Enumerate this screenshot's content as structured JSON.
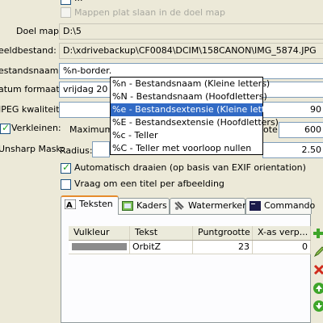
{
  "options": {
    "mirror_action_label": "...",
    "flatten_folders_label": "Mappen plat slaan in de doel map"
  },
  "form": {
    "target_folder_label": "Doel map:",
    "target_folder_value": "D:\\5",
    "example_file_label": "eeldbestand:",
    "example_file_value": "D:\\xdrivebackup\\CF0084\\DCIM\\158CANON\\IMG_5874.JPG",
    "filename_label": "estandsnaam:",
    "filename_value": "%n-border.",
    "date_format_label": "atum formaat:",
    "date_format_value": "vrijdag 20 ja",
    "jpeg_quality_label": "JPEG kwaliteit:",
    "jpeg_quality_value": "90",
    "resize_label": "Verkleinen:",
    "max_width_label": "Maximum bre",
    "max_height_label_tail": "ote:",
    "max_height_value": "600",
    "unsharp_label": "Unsharp Mask:",
    "radius_label": "Radius:",
    "radius_value": "2.50"
  },
  "dropdown": {
    "items": [
      "%n - Bestandsnaam (Kleine letters)",
      "%N - Bestandsnaam (Hoofdletters)",
      "%e - Bestandsextensie (Kleine letters)",
      "%E - Bestandsextensie (Hoofdletters)",
      "%c - Teller",
      "%C - Teller met voorloop nullen"
    ],
    "selected_index": 2
  },
  "checkboxes": {
    "auto_rotate_label": "Automatisch draaien (op basis van EXIF orientation)",
    "ask_title_label": "Vraag om een titel per afbeelding"
  },
  "tabs": [
    {
      "label": "Teksten"
    },
    {
      "label": "Kaders"
    },
    {
      "label": "Watermerken"
    },
    {
      "label": "Commando"
    }
  ],
  "grid": {
    "headers": [
      "Vulkleur",
      "Tekst",
      "Puntgrootte",
      "X-as verp..."
    ],
    "rows": [
      {
        "fill_color": "#8c8c8c",
        "text": "OrbitZ",
        "size": "23",
        "x_offset": "0"
      }
    ]
  },
  "colors": {
    "selection": "#316ac5",
    "tab_accent": "#e68b2c"
  }
}
